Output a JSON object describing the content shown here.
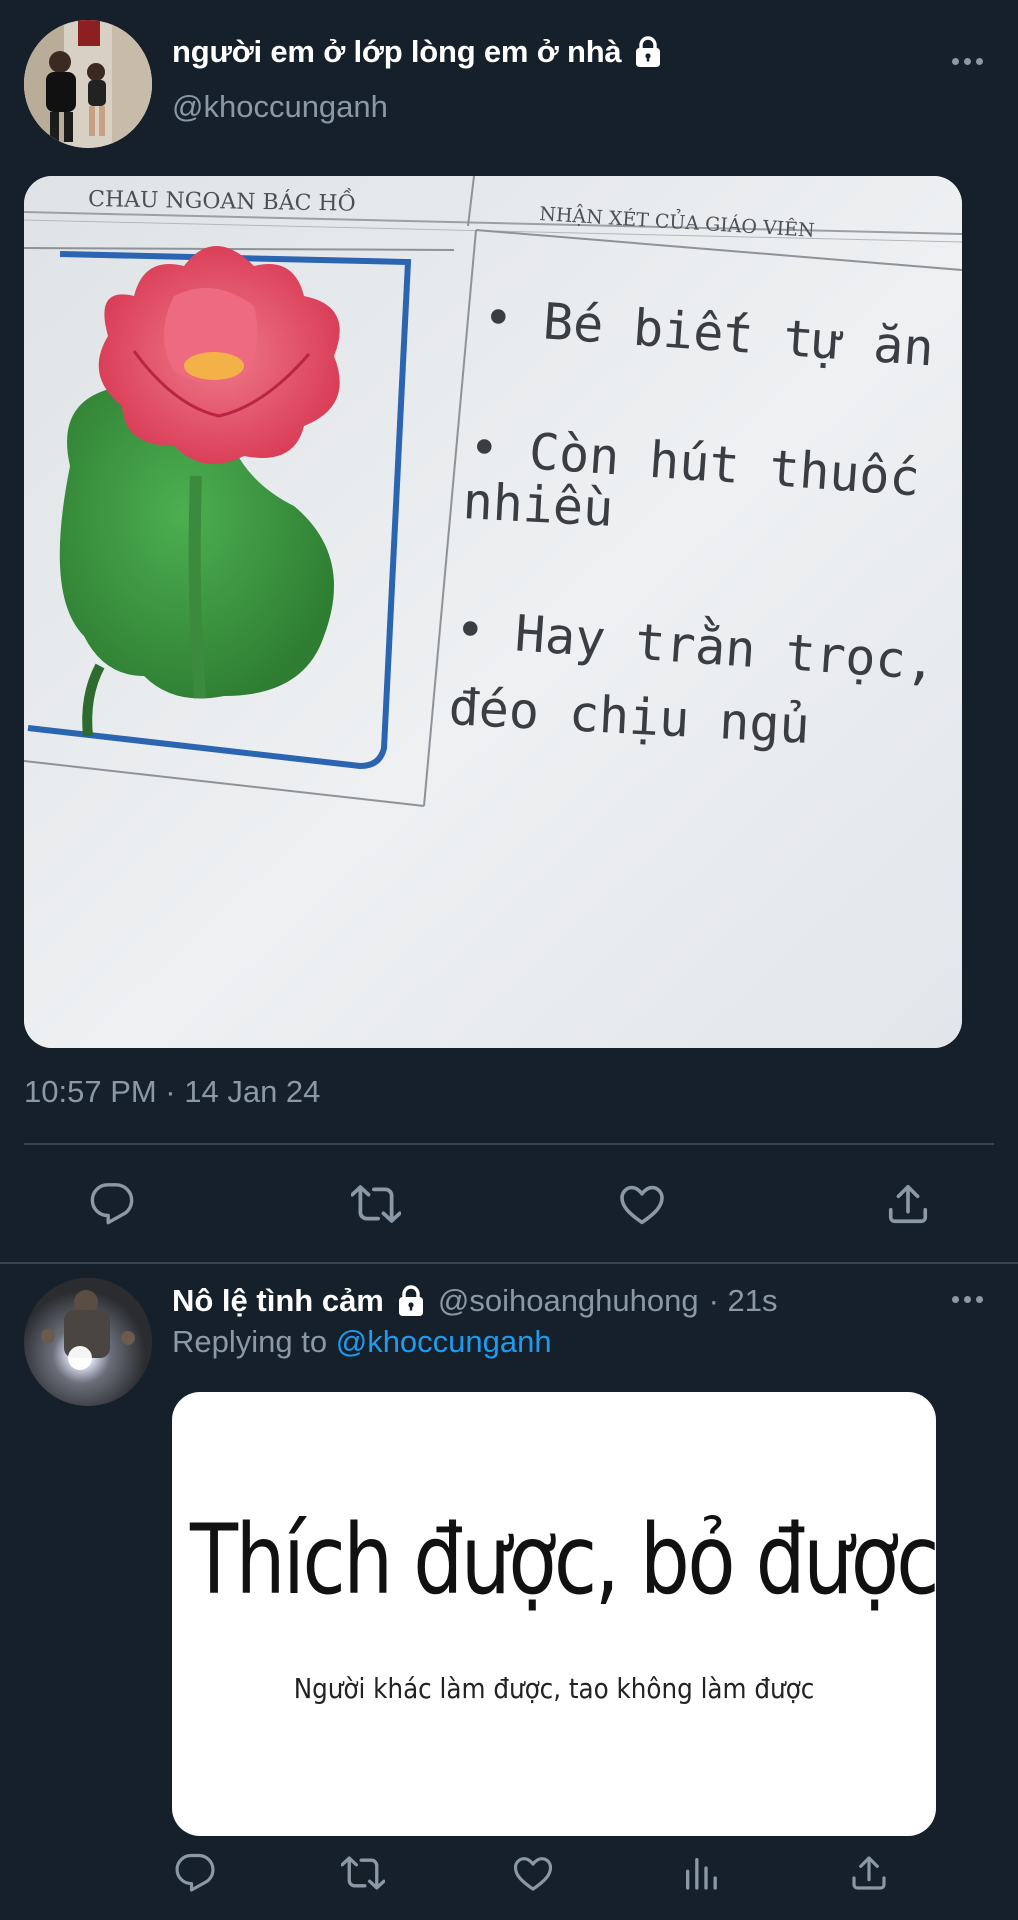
{
  "tweet": {
    "display_name": "người em ở lớp lòng em ở nhà",
    "handle": "@khoccunganh",
    "timestamp": "10:57 PM · 14 Jan 24",
    "image": {
      "header_left": "CHAU NGOAN BÁC HỒ",
      "header_right": "NHẬN XÉT CỦA GIÁO VIÊN",
      "line1": "• Bé biết tự ăn",
      "line2a": "• Còn hút thuốc",
      "line2b": "nhiều",
      "line3a": "• Hay trằn trọc,",
      "line3b": "đéo chịu ngủ"
    },
    "actions": [
      "reply-icon",
      "retweet-icon",
      "like-icon",
      "share-icon"
    ]
  },
  "reply": {
    "display_name": "Nô lệ tình cảm",
    "handle": "@soihoanghuhong",
    "time": "· 21s",
    "replying_prefix": "Replying to",
    "replying_mention": "@khoccunganh",
    "card_title": "Thích được, bỏ được",
    "card_subtitle": "Người khác làm được, tao không làm được",
    "actions": [
      "reply-icon",
      "retweet-icon",
      "like-icon",
      "analytics-icon",
      "share-icon"
    ]
  },
  "colors": {
    "background": "#15202b",
    "secondary_text": "#8b98a5",
    "divider": "#38444d",
    "link": "#1d9bf0"
  }
}
